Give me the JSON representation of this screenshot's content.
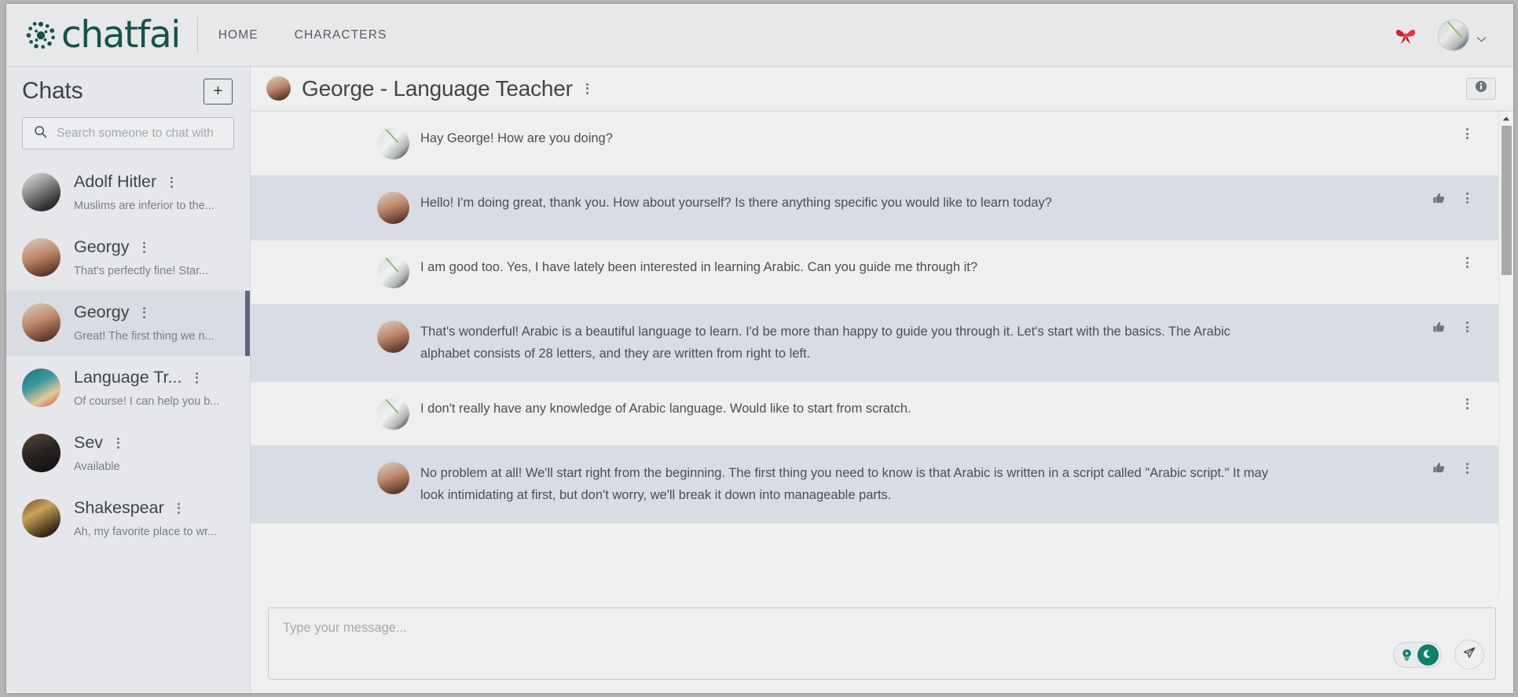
{
  "topbar": {
    "brand": "chatfai",
    "brand_icon": "chatfai-logo-icon",
    "nav": [
      {
        "label": "HOME",
        "name": "nav-home"
      },
      {
        "label": "CHARACTERS",
        "name": "nav-characters"
      }
    ],
    "ribbon_icon": "red-ribbon-icon",
    "avatar_icon": "user-avatar",
    "chevron_icon": "chevron-down-icon",
    "brand_color": "#14534c"
  },
  "sidebar": {
    "title": "Chats",
    "add_label": "+",
    "search": {
      "placeholder": "Search someone to chat with",
      "value": "",
      "icon": "search-icon"
    },
    "items": [
      {
        "name": "Adolf Hitler",
        "preview": "Muslims are inferior to the...",
        "avatar": "av-hitler",
        "active": false
      },
      {
        "name": "Georgy",
        "preview": "That's perfectly fine! Star...",
        "avatar": "av-georgy",
        "active": false
      },
      {
        "name": "Georgy",
        "preview": "Great! The first thing we n...",
        "avatar": "av-georgy",
        "active": true
      },
      {
        "name": "Language Tr...",
        "preview": "Of course! I can help you b...",
        "avatar": "av-lang",
        "active": false
      },
      {
        "name": "Sev",
        "preview": "Available",
        "avatar": "av-sev",
        "active": false
      },
      {
        "name": "Shakespear",
        "preview": "Ah, my favorite place to wr...",
        "avatar": "av-shake",
        "active": false
      }
    ]
  },
  "chat": {
    "title": "George - Language Teacher",
    "avatar": "av-georgy",
    "menu_icon": "kebab-menu-icon",
    "info_icon": "info-circle-icon",
    "messages": [
      {
        "role": "user",
        "avatar": "av-map",
        "text": "Hay George! How are you doing?",
        "has_like": false
      },
      {
        "role": "bot",
        "avatar": "av-georgy",
        "text": "Hello! I'm doing great, thank you. How about yourself? Is there anything specific you would like to learn today?",
        "has_like": true
      },
      {
        "role": "user",
        "avatar": "av-map",
        "text": "I am good too. Yes, I have lately been interested in learning Arabic. Can you guide me through it?",
        "has_like": false
      },
      {
        "role": "bot",
        "avatar": "av-georgy",
        "text": "That's wonderful! Arabic is a beautiful language to learn. I'd be more than happy to guide you through it. Let's start with the basics. The Arabic alphabet consists of 28 letters, and they are written from right to left.",
        "has_like": true
      },
      {
        "role": "user",
        "avatar": "av-map",
        "text": "I don't really have any knowledge of Arabic language. Would like to start from scratch.",
        "has_like": false
      },
      {
        "role": "bot",
        "avatar": "av-georgy",
        "text": "No problem at all! We'll start right from the beginning. The first thing you need to know is that Arabic is written in a script called \"Arabic script.\" It may look intimidating at first, but don't worry, we'll break it down into manageable parts.",
        "has_like": true
      }
    ],
    "like_icon": "thumbs-up-icon",
    "scrollbar_up_icon": "scroll-up-arrow-icon"
  },
  "composer": {
    "placeholder": "Type your message...",
    "value": "",
    "theme_toggle": {
      "light_icon": "lightbulb-icon",
      "dark_icon": "moon-icon",
      "accent": "#0f7f70"
    },
    "send_icon": "send-paper-plane-icon"
  }
}
